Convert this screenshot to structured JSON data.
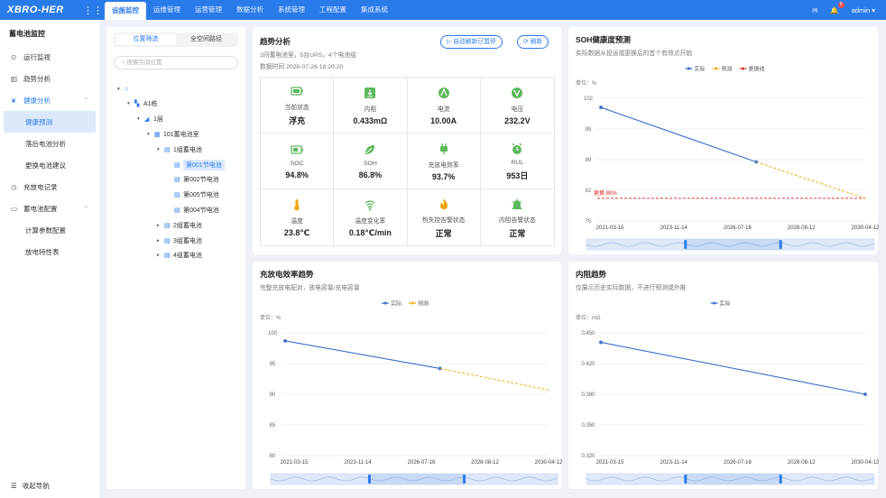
{
  "topbar": {
    "logo": "XBRO-HER",
    "tabs": [
      "设施监控",
      "运维管理",
      "运营管理",
      "数据分析",
      "系统管理",
      "工程配置",
      "集成系统"
    ],
    "active_tab": 0,
    "notification_count": "9",
    "user": "admin ▾"
  },
  "sidebar": {
    "title": "蓄电池监控",
    "items": [
      {
        "label": "运行监视",
        "icon": "dashboard-icon"
      },
      {
        "label": "趋势分析",
        "icon": "bar-chart-icon"
      },
      {
        "label": "健康分析",
        "icon": "leaf-icon",
        "expanded": true
      },
      {
        "label": "健康预测",
        "sub": true,
        "active": true
      },
      {
        "label": "落后电池分析",
        "sub": true
      },
      {
        "label": "更换电池建议",
        "sub": true
      },
      {
        "label": "充放电记录",
        "icon": "clock-icon"
      },
      {
        "label": "蓄电池配置",
        "icon": "battery-icon",
        "expanded": true
      },
      {
        "label": "计算参数配置",
        "sub": true
      },
      {
        "label": "放电特性表",
        "sub": true
      }
    ],
    "footer": "收起导航"
  },
  "tree": {
    "seg": [
      "位置筛选",
      "全空间路径"
    ],
    "search_placeholder": "搜索空间位置",
    "nodes": [
      {
        "label": "",
        "level": 0,
        "arrow": "▾",
        "icon": "home-icon"
      },
      {
        "label": "A1栋",
        "level": 1,
        "arrow": "▾",
        "icon": "building-icon"
      },
      {
        "label": "1层",
        "level": 2,
        "arrow": "▾",
        "icon": "floor-icon"
      },
      {
        "label": "101蓄电池室",
        "level": 3,
        "arrow": "▾",
        "icon": "room-icon"
      },
      {
        "label": "1组蓄电池",
        "level": 4,
        "arrow": "▾",
        "icon": "group-icon"
      },
      {
        "label": "第001节电池",
        "level": 5,
        "arrow": "",
        "icon": "cell-icon",
        "selected": true
      },
      {
        "label": "第002节电池",
        "level": 5,
        "arrow": "",
        "icon": "cell-icon"
      },
      {
        "label": "第005节电池",
        "level": 5,
        "arrow": "",
        "icon": "cell-icon"
      },
      {
        "label": "第004节电池",
        "level": 5,
        "arrow": "",
        "icon": "cell-icon"
      },
      {
        "label": "2组蓄电池",
        "level": 4,
        "arrow": "▸",
        "icon": "group-icon"
      },
      {
        "label": "3组蓄电池",
        "level": 4,
        "arrow": "▸",
        "icon": "group-icon"
      },
      {
        "label": "4组蓄电池",
        "level": 4,
        "arrow": "▸",
        "icon": "group-icon"
      }
    ]
  },
  "trend": {
    "title": "趋势分析",
    "sub": "2间蓄电池室，5台UPS，4个电池组",
    "time": "数据时间 2026-07-26 18:20:20",
    "btn_auto": "自动刷新已暂停",
    "btn_refresh": "刷新",
    "metrics": [
      {
        "label": "当前状态",
        "value": "浮充",
        "icon": "battery-status-icon"
      },
      {
        "label": "内阻",
        "value": "0.433mΩ",
        "icon": "resistance-icon"
      },
      {
        "label": "电流",
        "value": "10.00A",
        "icon": "current-icon"
      },
      {
        "label": "电压",
        "value": "232.2V",
        "icon": "voltage-icon"
      },
      {
        "label": "SOC",
        "value": "94.8%",
        "icon": "soc-icon"
      },
      {
        "label": "SOH",
        "value": "86.8%",
        "icon": "soh-leaf-icon"
      },
      {
        "label": "充放电效率",
        "value": "93.7%",
        "icon": "plug-icon"
      },
      {
        "label": "RUL",
        "value": "953日",
        "icon": "alarm-clock-icon"
      },
      {
        "label": "温度",
        "value": "23.8℃",
        "icon": "thermometer-icon"
      },
      {
        "label": "温度变化率",
        "value": "0.18℃/min",
        "icon": "temp-rate-icon"
      },
      {
        "label": "热失控告警状态",
        "value": "正常",
        "icon": "fire-icon"
      },
      {
        "label": "内阻告警状态",
        "value": "正常",
        "icon": "siren-icon"
      }
    ]
  },
  "colors": {
    "accent": "#2a7bea",
    "actual": "#3d6ccc",
    "predict": "#f0a500",
    "threshold": "#e02020"
  },
  "chart_data": [
    {
      "type": "line",
      "title": "SOH健康度预测",
      "subtitle": "实际数据从投运或更换后的首个有效点开始",
      "unit_label": "单位：%",
      "ylim": [
        75,
        102
      ],
      "yticks": [
        102,
        95,
        89,
        82,
        75
      ],
      "xticks": [
        "2021-03-15",
        "2023-11-14",
        "2026-07-16",
        "2028-08-12",
        "2030-04-12"
      ],
      "legend": [
        "实际",
        "预测",
        "更换线"
      ],
      "series": [
        {
          "name": "实际",
          "points": [
            [
              "2021-03-15",
              100
            ],
            [
              "2026-07-16",
              88
            ]
          ]
        },
        {
          "name": "预测",
          "points": [
            [
              "2026-07-16",
              88
            ],
            [
              "2030-04-12",
              80
            ]
          ]
        }
      ],
      "threshold": {
        "name": "更换线",
        "value": 80,
        "label": "更换 80%"
      }
    },
    {
      "type": "line",
      "title": "充放电效率趋势",
      "subtitle": "完整充放电配对，放电容量/充电容量",
      "unit_label": "单位：%",
      "ylim": [
        80,
        100
      ],
      "yticks": [
        100,
        95,
        90,
        85,
        80
      ],
      "xticks": [
        "2021-03-15",
        "2023-11-14",
        "2026-07-16",
        "2028-08-12",
        "2030-04-12"
      ],
      "legend": [
        "实际",
        "预测"
      ],
      "series": [
        {
          "name": "实际",
          "points": [
            [
              "2021-03-15",
              98.7
            ],
            [
              "2026-07-16",
              94.2
            ]
          ]
        },
        {
          "name": "预测",
          "points": [
            [
              "2026-07-16",
              94.2
            ],
            [
              "2030-04-12",
              90.7
            ]
          ]
        }
      ]
    },
    {
      "type": "line",
      "title": "内阻趋势",
      "subtitle": "仅展示历史实际数据，不进行预测或外推",
      "unit_label": "单位：mΩ",
      "ylim": [
        0.32,
        0.45
      ],
      "yticks": [
        "0.450",
        "0.420",
        "0.380",
        "0.350",
        "0.320"
      ],
      "xticks": [
        "2021-03-15",
        "2023-11-14",
        "2026-07-16",
        "2028-08-12",
        "2030-04-12"
      ],
      "legend": [
        "实际"
      ],
      "series": [
        {
          "name": "实际",
          "points": [
            [
              "2021-03-15",
              0.44
            ],
            [
              "2030-04-12",
              0.385
            ]
          ]
        }
      ]
    }
  ]
}
